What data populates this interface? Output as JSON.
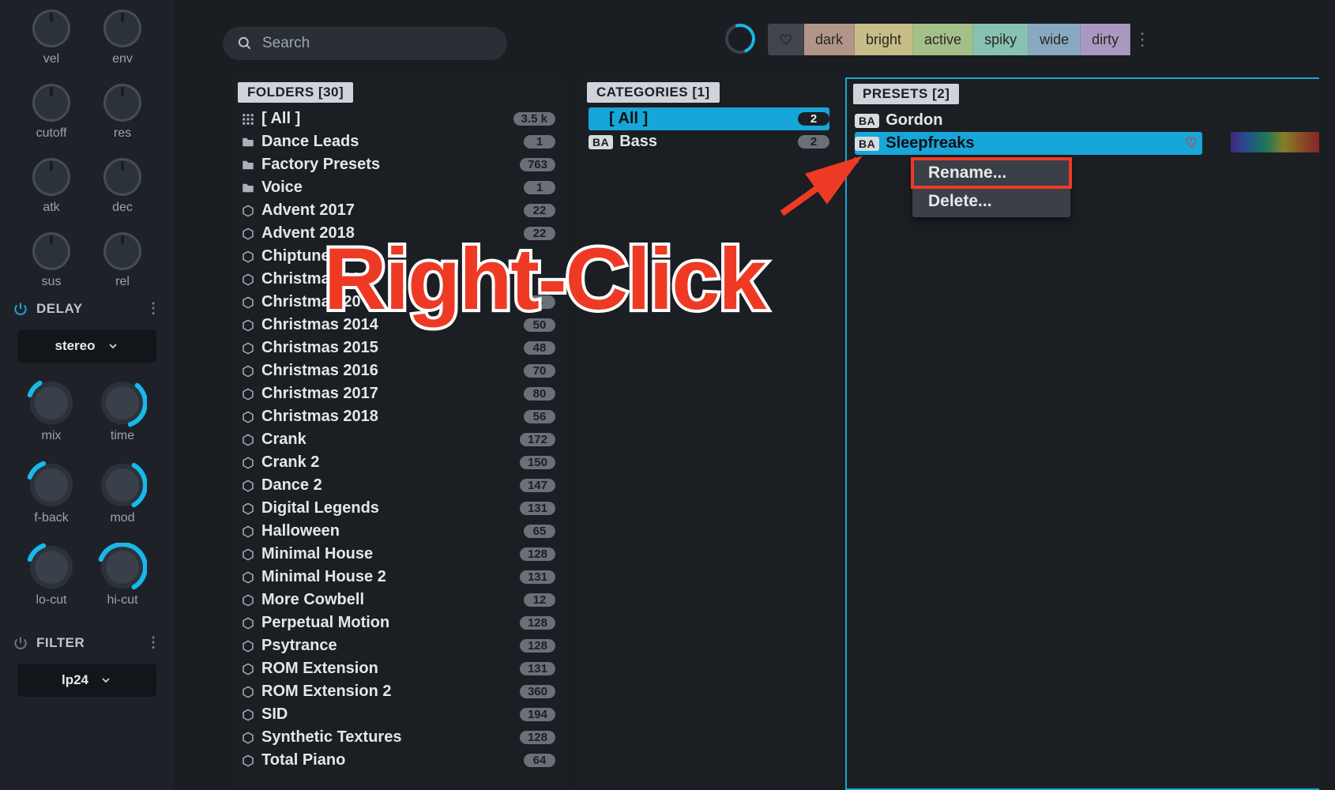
{
  "side": {
    "knobs": [
      "vel",
      "env",
      "cutoff",
      "res",
      "atk",
      "dec",
      "sus",
      "rel"
    ],
    "delay": {
      "title": "DELAY",
      "mode": "stereo",
      "knobs": [
        "mix",
        "time",
        "f-back",
        "mod",
        "lo-cut",
        "hi-cut"
      ]
    },
    "filter": {
      "title": "FILTER",
      "mode": "lp24"
    }
  },
  "search": {
    "placeholder": "Search"
  },
  "tags": [
    "dark",
    "bright",
    "active",
    "spiky",
    "wide",
    "dirty"
  ],
  "tag_colors": [
    "#d9b4a4",
    "#f3e6a3",
    "#c7e9a4",
    "#a4e9d6",
    "#a4cde9",
    "#d0b7e9"
  ],
  "folders": {
    "title": "FOLDERS [30]",
    "items": [
      {
        "icon": "grid",
        "name": "[ All ]",
        "count": "3.5 k"
      },
      {
        "icon": "folder",
        "name": "Dance Leads",
        "count": "1"
      },
      {
        "icon": "folder",
        "name": "Factory Presets",
        "count": "763"
      },
      {
        "icon": "folder",
        "name": "Voice",
        "count": "1"
      },
      {
        "icon": "cube",
        "name": "Advent 2017",
        "count": "22"
      },
      {
        "icon": "cube",
        "name": "Advent 2018",
        "count": "22"
      },
      {
        "icon": "cube",
        "name": "Chiptune",
        "count": ""
      },
      {
        "icon": "cube",
        "name": "Christmas 20",
        "count": ""
      },
      {
        "icon": "cube",
        "name": "Christmas 20",
        "count": "6"
      },
      {
        "icon": "cube",
        "name": "Christmas 2014",
        "count": "50"
      },
      {
        "icon": "cube",
        "name": "Christmas 2015",
        "count": "48"
      },
      {
        "icon": "cube",
        "name": "Christmas 2016",
        "count": "70"
      },
      {
        "icon": "cube",
        "name": "Christmas 2017",
        "count": "80"
      },
      {
        "icon": "cube",
        "name": "Christmas 2018",
        "count": "56"
      },
      {
        "icon": "cube",
        "name": "Crank",
        "count": "172"
      },
      {
        "icon": "cube",
        "name": "Crank 2",
        "count": "150"
      },
      {
        "icon": "cube",
        "name": "Dance 2",
        "count": "147"
      },
      {
        "icon": "cube",
        "name": "Digital Legends",
        "count": "131"
      },
      {
        "icon": "cube",
        "name": "Halloween",
        "count": "65"
      },
      {
        "icon": "cube",
        "name": "Minimal House",
        "count": "128"
      },
      {
        "icon": "cube",
        "name": "Minimal House 2",
        "count": "131"
      },
      {
        "icon": "cube",
        "name": "More Cowbell",
        "count": "12"
      },
      {
        "icon": "cube",
        "name": "Perpetual Motion",
        "count": "128"
      },
      {
        "icon": "cube",
        "name": "Psytrance",
        "count": "128"
      },
      {
        "icon": "cube",
        "name": "ROM Extension",
        "count": "131"
      },
      {
        "icon": "cube",
        "name": "ROM Extension 2",
        "count": "360"
      },
      {
        "icon": "cube",
        "name": "SID",
        "count": "194"
      },
      {
        "icon": "cube",
        "name": "Synthetic Textures",
        "count": "128"
      },
      {
        "icon": "cube",
        "name": "Total Piano",
        "count": "64"
      }
    ]
  },
  "categories": {
    "title": "CATEGORIES [1]",
    "items": [
      {
        "badge": "",
        "name": "[ All ]",
        "count": "2",
        "selected": true
      },
      {
        "badge": "BA",
        "name": "Bass",
        "count": "2"
      }
    ]
  },
  "presets": {
    "title": "PRESETS [2]",
    "items": [
      {
        "badge": "BA",
        "name": "Gordon"
      },
      {
        "badge": "BA",
        "name": "Sleepfreaks",
        "selected": true,
        "heart": true
      }
    ]
  },
  "context_menu": {
    "items": [
      "Rename...",
      "Delete..."
    ],
    "highlighted": 0
  },
  "annotation": {
    "text": "Right-Click"
  }
}
